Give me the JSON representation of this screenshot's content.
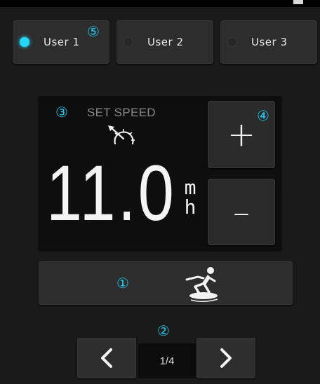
{
  "colors": {
    "accent": "#26d6f5",
    "badge": "#22c6f0",
    "background": "#1a1a1a",
    "panel": "#0e0e0e",
    "button": "#2d2d2d"
  },
  "badges": [
    "①",
    "②",
    "③",
    "④",
    "⑤"
  ],
  "users": [
    {
      "label": "User 1",
      "active": true
    },
    {
      "label": "User 2",
      "active": false
    },
    {
      "label": "User 3",
      "active": false
    }
  ],
  "speed": {
    "title": "SET SPEED",
    "value": "11.0",
    "unit": "mh",
    "icon": "speedometer-arrow-icon"
  },
  "controls": {
    "increase_label": "+",
    "decrease_label": "–"
  },
  "mode": {
    "icon": "wakeboard-skier-icon"
  },
  "pagination": {
    "prev_icon": "chevron-left-icon",
    "next_icon": "chevron-right-icon",
    "current": 1,
    "total": 4,
    "text": "1/4"
  }
}
